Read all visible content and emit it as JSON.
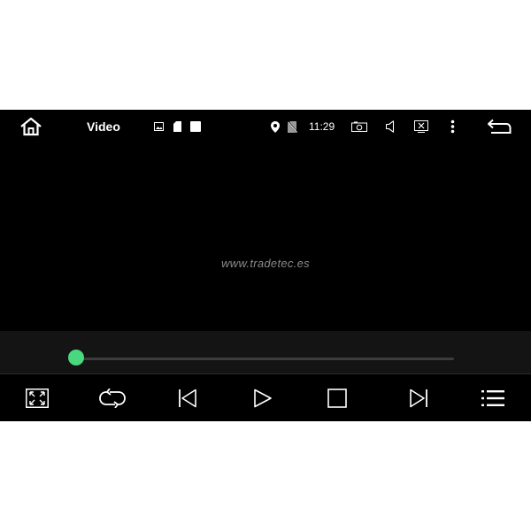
{
  "statusbar": {
    "title": "Video",
    "time": "11:29",
    "icons": [
      "home-icon",
      "image-icon",
      "sd-card-icon",
      "square-icon",
      "location-icon",
      "no-sim-icon",
      "camera-icon",
      "volume-icon",
      "close-box-icon",
      "more-vert-icon",
      "back-icon"
    ]
  },
  "video": {
    "watermark": "www.tradetec.es"
  },
  "progress": {
    "position_fraction": 0.0,
    "accent_color": "#49d87e"
  },
  "controls": {
    "buttons": [
      "fullscreen-icon",
      "repeat-icon",
      "previous-icon",
      "play-icon",
      "stop-icon",
      "next-icon",
      "playlist-icon"
    ]
  },
  "colors": {
    "background": "#000000",
    "panel": "#141414",
    "foreground": "#ffffff"
  }
}
